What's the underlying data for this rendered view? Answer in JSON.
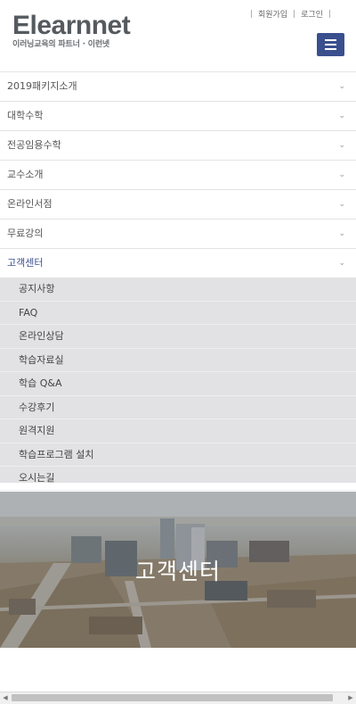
{
  "header": {
    "logo_main": "Elearnnet",
    "logo_sub": "이러닝교육의 파트너 · 이런넷",
    "links": [
      "회원가입",
      "로그인"
    ]
  },
  "nav": {
    "items": [
      {
        "label": "2019패키지소개"
      },
      {
        "label": "대학수학"
      },
      {
        "label": "전공임용수학"
      },
      {
        "label": "교수소개"
      },
      {
        "label": "온라인서점"
      },
      {
        "label": "무료강의"
      },
      {
        "label": "고객센터"
      }
    ],
    "chevron": "⌄"
  },
  "submenu": {
    "items": [
      {
        "label": "공지사항"
      },
      {
        "label": "FAQ"
      },
      {
        "label": "온라인상담"
      },
      {
        "label": "학습자료실"
      },
      {
        "label": "학습 Q&A"
      },
      {
        "label": "수강후기"
      },
      {
        "label": "원격지원"
      },
      {
        "label": "학습프로그램 설치"
      },
      {
        "label": "오시는길"
      }
    ]
  },
  "banner": {
    "title": "고객센터"
  },
  "colors": {
    "accent": "#3a4f8e",
    "submenu_bg": "#e2e2e4"
  }
}
